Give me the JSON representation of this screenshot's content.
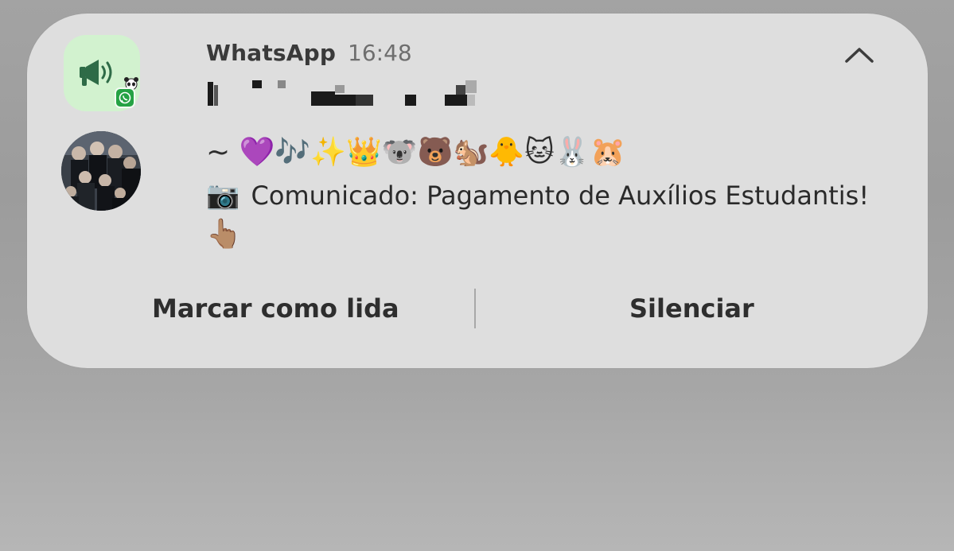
{
  "notification": {
    "app_name": "WhatsApp",
    "time": "16:48",
    "sender_redacted": "",
    "emoji_line": "~ 💜🎶✨👑🐨🐻🐿️🐥🐱🐰🐹",
    "camera_emoji": "📷",
    "message_text": "Comunicado: Pagamento de Auxílios Estudantis!",
    "pointer_emoji": "👆🏽",
    "collapse_icon": "chevron-up-icon",
    "app_icon": "megaphone-icon",
    "badge_icon": "whatsapp-icon"
  },
  "actions": {
    "mark_read_label": "Marcar como lida",
    "mute_label": "Silenciar"
  },
  "colors": {
    "card_bg": "#dedede",
    "app_icon_bg": "#d2f2cf",
    "whatsapp_green": "#25a244",
    "megaphone": "#2e6b47"
  }
}
